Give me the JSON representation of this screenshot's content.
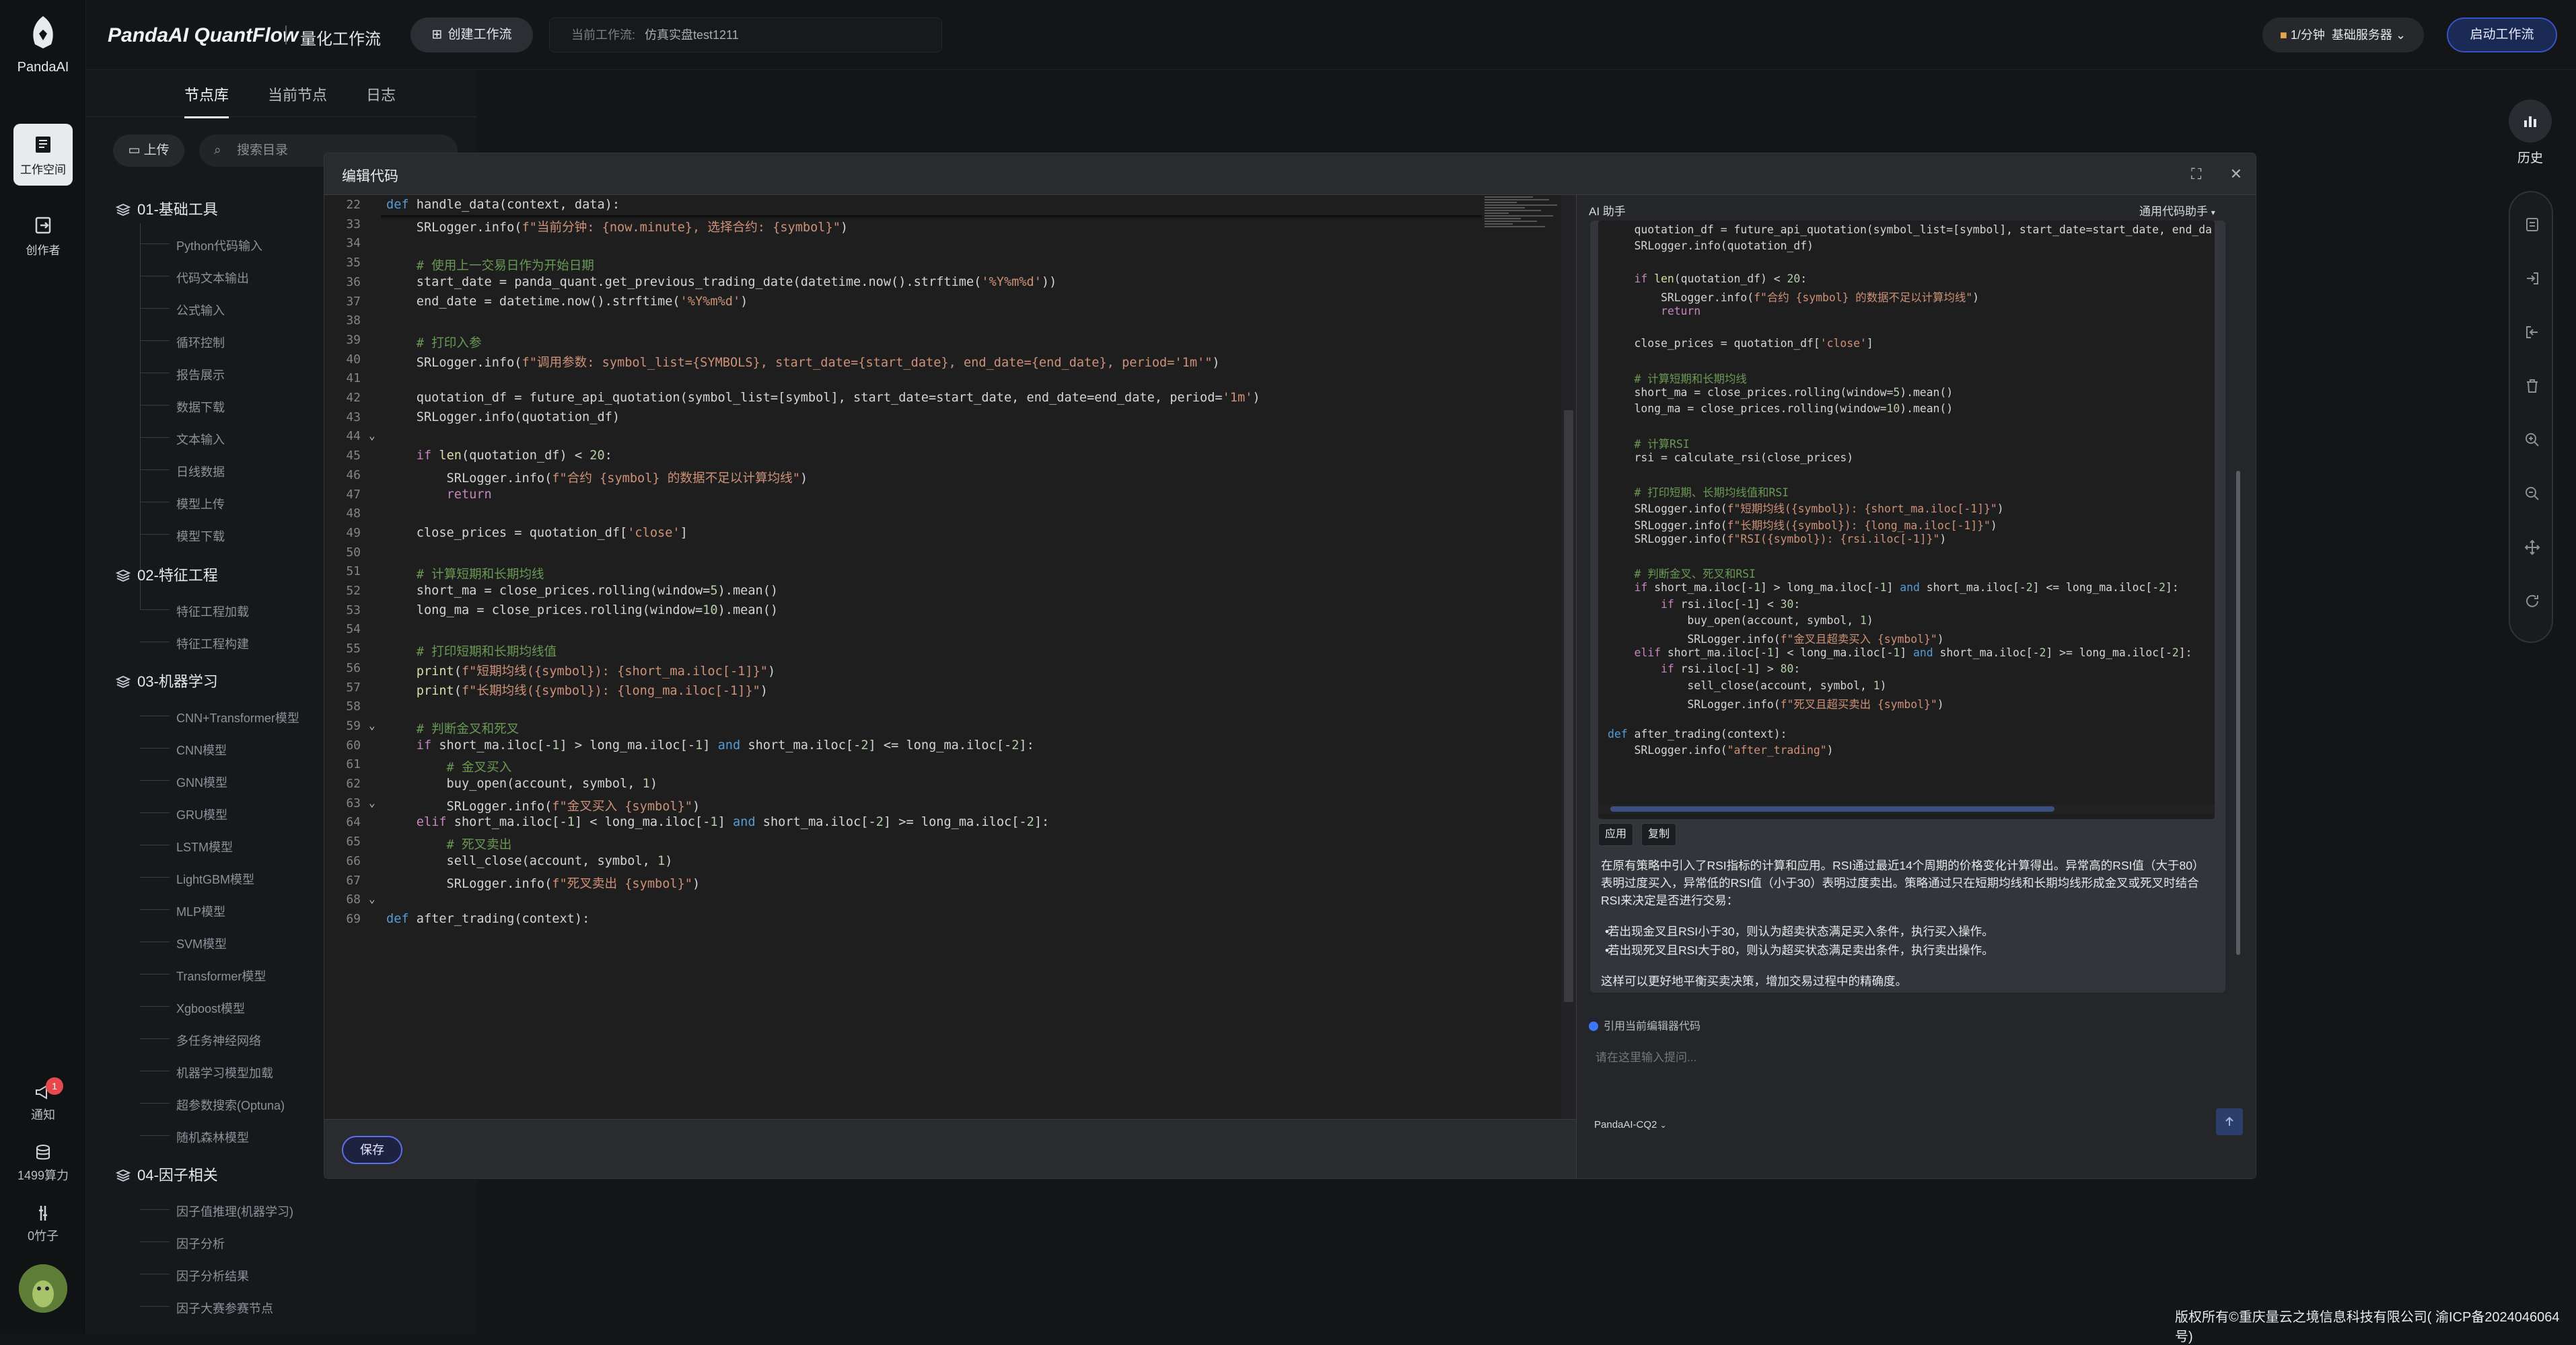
{
  "app": {
    "logo_text": "PandaAI",
    "title": "PandaAI QuantFlow",
    "subtitle": "量化工作流",
    "create_button": "创建工作流",
    "current_label": "当前工作流:",
    "current_name": "仿真实盘test1211",
    "rate": "1/分钟",
    "server": "基础服务器",
    "run_button": "启动工作流"
  },
  "rail": {
    "workspace": "工作空间",
    "creator": "创作者",
    "notify": "通知",
    "notify_count": "1",
    "compute": "1499算力",
    "bamboo": "0竹子"
  },
  "library": {
    "tabs": [
      "节点库",
      "当前节点",
      "日志"
    ],
    "upload": "上传",
    "search_placeholder": "搜索目录",
    "categories": [
      {
        "name": "01-基础工具",
        "items": [
          "Python代码输入",
          "代码文本输出",
          "公式输入",
          "循环控制",
          "报告展示",
          "数据下载",
          "文本输入",
          "日线数据",
          "模型上传",
          "模型下载"
        ]
      },
      {
        "name": "02-特征工程",
        "items": [
          "特征工程加载",
          "特征工程构建"
        ]
      },
      {
        "name": "03-机器学习",
        "items": [
          "CNN+Transformer模型",
          "CNN模型",
          "GNN模型",
          "GRU模型",
          "LSTM模型",
          "LightGBM模型",
          "MLP模型",
          "SVM模型",
          "Transformer模型",
          "Xgboost模型",
          "多任务神经网络",
          "机器学习模型加载",
          "超参数搜索(Optuna)",
          "随机森林模型"
        ]
      },
      {
        "name": "04-因子相关",
        "items": [
          "因子值推理(机器学习)",
          "因子分析",
          "因子分析结果",
          "因子大赛参赛节点"
        ]
      }
    ]
  },
  "right_sidebar": {
    "history": "历史"
  },
  "footer": "版权所有©重庆量云之境信息科技有限公司( 渝ICP备2024046064号)",
  "editor": {
    "title": "编辑代码",
    "save": "保存",
    "line_numbers": [
      "22",
      "33",
      "34",
      "35",
      "36",
      "37",
      "38",
      "39",
      "40",
      "41",
      "42",
      "43",
      "44",
      "45",
      "46",
      "47",
      "48",
      "49",
      "50",
      "51",
      "52",
      "53",
      "54",
      "55",
      "56",
      "57",
      "58",
      "59",
      "60",
      "61",
      "62",
      "63",
      "64",
      "65",
      "66",
      "67",
      "68",
      "69"
    ],
    "lines": [
      "def handle_data(context, data):",
      "    SRLogger.info(f\"当前分钟: {now.minute}, 选择合约: {symbol}\")",
      "",
      "    # 使用上一交易日作为开始日期",
      "    start_date = panda_quant.get_previous_trading_date(datetime.now().strftime('%Y%m%d'))",
      "    end_date = datetime.now().strftime('%Y%m%d')",
      "",
      "    # 打印入参",
      "    SRLogger.info(f\"调用参数: symbol_list={SYMBOLS}, start_date={start_date}, end_date={end_date}, period='1m'\")",
      "",
      "    quotation_df = future_api_quotation(symbol_list=[symbol], start_date=start_date, end_date=end_date, period='1m')",
      "    SRLogger.info(quotation_df)",
      "",
      "    if len(quotation_df) < 20:",
      "        SRLogger.info(f\"合约 {symbol} 的数据不足以计算均线\")",
      "        return",
      "",
      "    close_prices = quotation_df['close']",
      "",
      "    # 计算短期和长期均线",
      "    short_ma = close_prices.rolling(window=5).mean()",
      "    long_ma = close_prices.rolling(window=10).mean()",
      "",
      "    # 打印短期和长期均线值",
      "    print(f\"短期均线({symbol}): {short_ma.iloc[-1]}\")",
      "    print(f\"长期均线({symbol}): {long_ma.iloc[-1]}\")",
      "",
      "    # 判断金叉和死叉",
      "    if short_ma.iloc[-1] > long_ma.iloc[-1] and short_ma.iloc[-2] <= long_ma.iloc[-2]:",
      "        # 金叉买入",
      "        buy_open(account, symbol, 1)",
      "        SRLogger.info(f\"金叉买入 {symbol}\")",
      "    elif short_ma.iloc[-1] < long_ma.iloc[-1] and short_ma.iloc[-2] >= long_ma.iloc[-2]:",
      "        # 死叉卖出",
      "        sell_close(account, symbol, 1)",
      "        SRLogger.info(f\"死叉卖出 {symbol}\")",
      "",
      "def after_trading(context):",
      "    SRLogger.info(\"after_trading\")"
    ]
  },
  "ai": {
    "title": "AI 助手",
    "mode": "通用代码助手",
    "code_lines": [
      "    quotation_df = future_api_quotation(symbol_list=[symbol], start_date=start_date, end_da",
      "    SRLogger.info(quotation_df)",
      "",
      "    if len(quotation_df) < 20:",
      "        SRLogger.info(f\"合约 {symbol} 的数据不足以计算均线\")",
      "        return",
      "",
      "    close_prices = quotation_df['close']",
      "",
      "    # 计算短期和长期均线",
      "    short_ma = close_prices.rolling(window=5).mean()",
      "    long_ma = close_prices.rolling(window=10).mean()",
      "",
      "    # 计算RSI",
      "    rsi = calculate_rsi(close_prices)",
      "",
      "    # 打印短期、长期均线值和RSI",
      "    SRLogger.info(f\"短期均线({symbol}): {short_ma.iloc[-1]}\")",
      "    SRLogger.info(f\"长期均线({symbol}): {long_ma.iloc[-1]}\")",
      "    SRLogger.info(f\"RSI({symbol}): {rsi.iloc[-1]}\")",
      "",
      "    # 判断金叉、死叉和RSI",
      "    if short_ma.iloc[-1] > long_ma.iloc[-1] and short_ma.iloc[-2] <= long_ma.iloc[-2]:",
      "        if rsi.iloc[-1] < 30:",
      "            buy_open(account, symbol, 1)",
      "            SRLogger.info(f\"金叉且超卖买入 {symbol}\")",
      "    elif short_ma.iloc[-1] < long_ma.iloc[-1] and short_ma.iloc[-2] >= long_ma.iloc[-2]:",
      "        if rsi.iloc[-1] > 80:",
      "            sell_close(account, symbol, 1)",
      "            SRLogger.info(f\"死叉且超买卖出 {symbol}\")",
      "",
      "def after_trading(context):",
      "    SRLogger.info(\"after_trading\")"
    ],
    "apply": "应用",
    "copy": "复制",
    "para1_l1": "在原有策略中引入了RSI指标的计算和应用。RSI通过最近14个周期的价格变化计算得出。异常高的RSI值（大于80）",
    "para1_l2": "表明过度买入，异常低的RSI值（小于30）表明过度卖出。策略通过只在短期均线和长期均线形成金叉或死叉时结合",
    "para1_l3": "RSI来决定是否进行交易：",
    "bullet1": "若出现金叉且RSI小于30，则认为超卖状态满足买入条件，执行买入操作。",
    "bullet2": "若出现死叉且RSI大于80，则认为超买状态满足卖出条件，执行卖出操作。",
    "para2": "这样可以更好地平衡买卖决策，增加交易过程中的精确度。",
    "ref_label": "引用当前编辑器代码",
    "input_placeholder": "请在这里输入提问...",
    "model": "PandaAI-CQ2"
  }
}
